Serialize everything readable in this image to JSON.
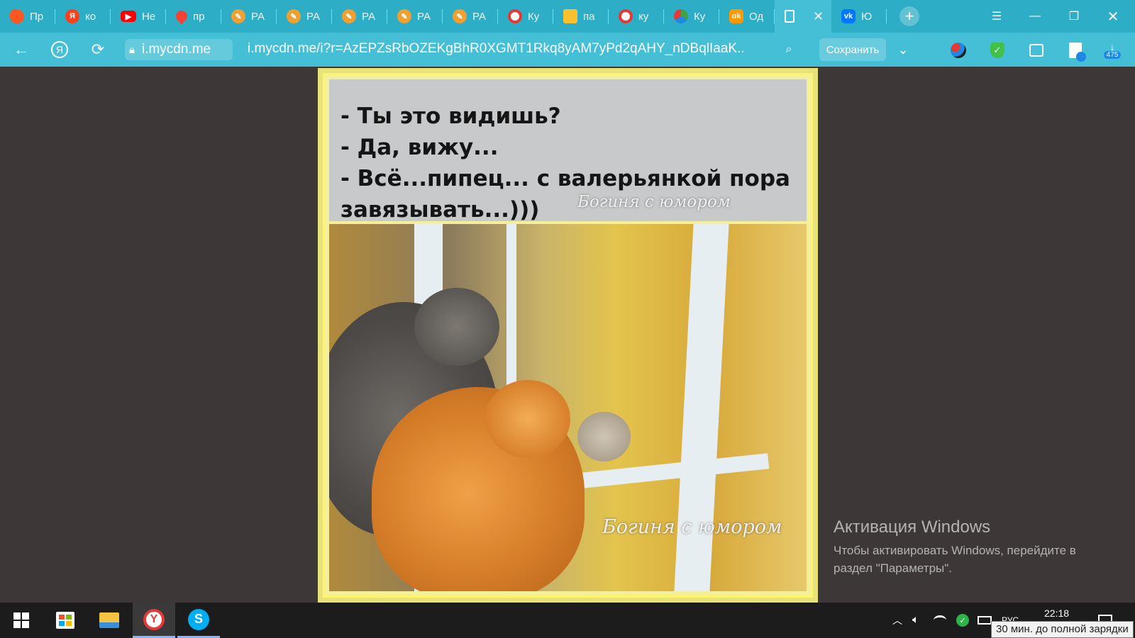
{
  "browser": {
    "tabs": [
      {
        "label": "Пр",
        "icon": "cloud-icon",
        "color": "#ff5722"
      },
      {
        "label": "ко",
        "icon": "yandex-icon",
        "color": "#fc3f1d"
      },
      {
        "label": "Не",
        "icon": "youtube-icon",
        "color": "#ff0000"
      },
      {
        "label": "пр",
        "icon": "map-pin-icon",
        "color": "#f44336"
      },
      {
        "label": "РА",
        "icon": "pen-icon",
        "color": "#f0a030"
      },
      {
        "label": "РА",
        "icon": "pen-icon",
        "color": "#f0a030"
      },
      {
        "label": "РА",
        "icon": "pen-icon",
        "color": "#f0a030"
      },
      {
        "label": "РА",
        "icon": "pen-icon",
        "color": "#f0a030"
      },
      {
        "label": "РА",
        "icon": "pen-icon",
        "color": "#f0a030"
      },
      {
        "label": "Ку",
        "icon": "search-red-icon",
        "color": "#e53935"
      },
      {
        "label": "па",
        "icon": "photo-icon",
        "color": "#fbc02d"
      },
      {
        "label": "ку",
        "icon": "opera-icon",
        "color": "#e53935"
      },
      {
        "label": "Ку",
        "icon": "colors-icon",
        "color": "#43a047"
      },
      {
        "label": "Од",
        "icon": "odnoklassniki-icon",
        "color": "#ff9800"
      },
      {
        "label": "",
        "icon": "document-icon",
        "color": "#ffffff",
        "active": true
      },
      {
        "label": "Ю",
        "icon": "vk-icon",
        "color": "#0077ff"
      }
    ],
    "domain_chip": "i.mycdn.me",
    "url": "i.mycdn.me/i?r=AzEPZsRbOZEKgBhR0XGMT1Rkq8yAM7yPd2qAHY_nDBqlIaaK...",
    "save_label": "Сохранить",
    "downloads_count": "475"
  },
  "image": {
    "caption_lines": [
      "- Ты это видишь?",
      "- Да, вижу...",
      "- Всё...пипец... с валерьянкой пора",
      "завязывать...)))"
    ],
    "watermark_top": "Богиня с юмором",
    "watermark_bottom": "Богиня с юмором"
  },
  "activation": {
    "title": "Активация Windows",
    "line1": "Чтобы активировать Windows, перейдите в",
    "line2": "раздел \"Параметры\"."
  },
  "taskbar": {
    "lang": "РУС",
    "time": "22:18",
    "tooltip": "30 мин. до полной зарядки"
  }
}
